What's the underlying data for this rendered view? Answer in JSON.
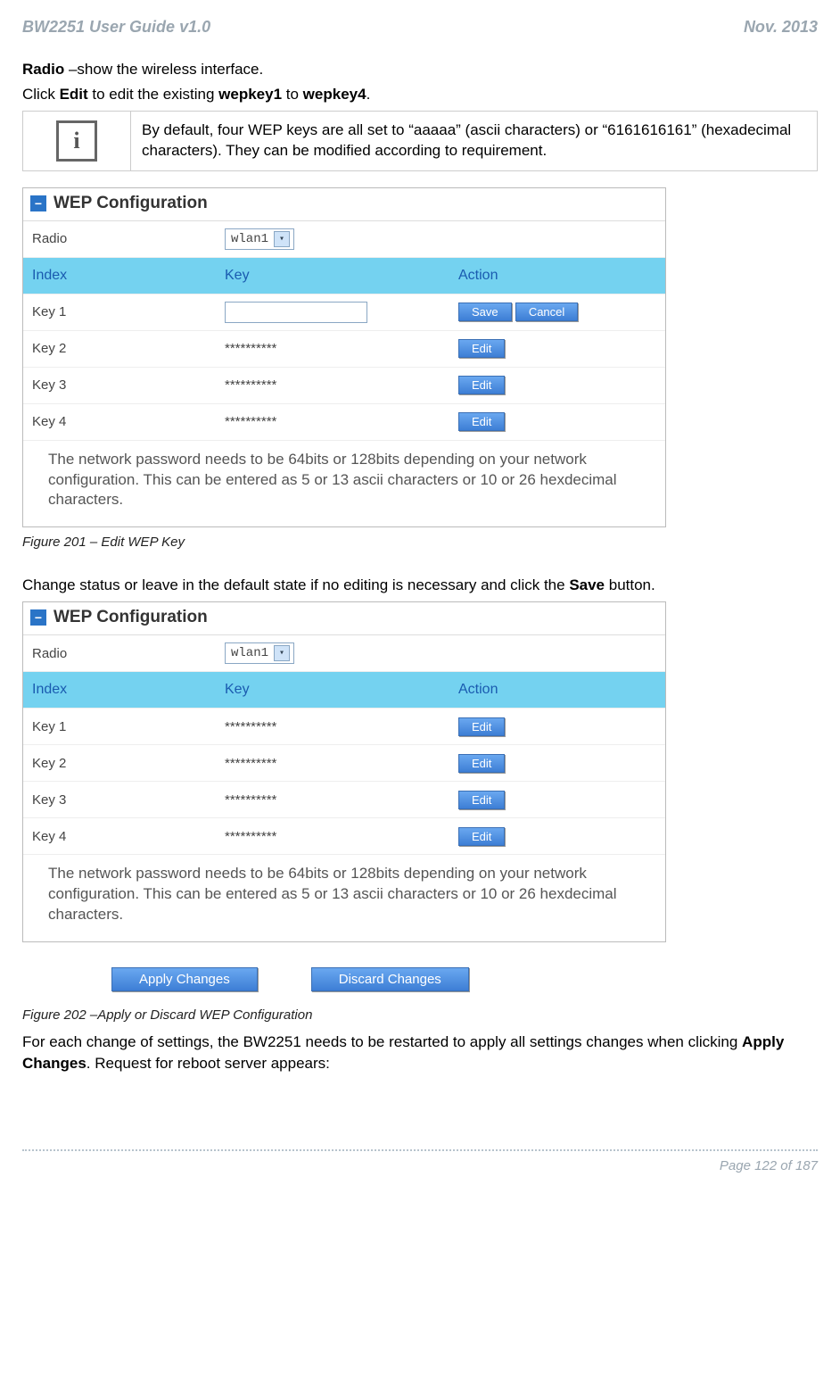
{
  "header": {
    "left": "BW2251 User Guide v1.0",
    "right": "Nov.  2013"
  },
  "intro": {
    "line1_pre": "Radio",
    "line1_rest": " –show the wireless interface.",
    "line2_pre": "Click ",
    "line2_b1": "Edit",
    "line2_mid": " to edit the existing ",
    "line2_b2": "wepkey1",
    "line2_mid2": " to ",
    "line2_b3": "wepkey4",
    "line2_end": "."
  },
  "note": {
    "icon_letter": "i",
    "text": "By default, four WEP keys are all set to “aaaaa” (ascii characters) or “6161616161” (hexadecimal characters). They can be modified according to requirement."
  },
  "panel": {
    "toggle": "−",
    "title": "WEP Configuration",
    "radio_label": "Radio",
    "radio_value": "wlan1",
    "col_index": "Index",
    "col_key": "Key",
    "col_action": "Action",
    "rows1": [
      {
        "label": "Key 1",
        "value": "",
        "mode": "edit"
      },
      {
        "label": "Key 2",
        "value": "**********",
        "mode": "view"
      },
      {
        "label": "Key 3",
        "value": "**********",
        "mode": "view"
      },
      {
        "label": "Key 4",
        "value": "**********",
        "mode": "view"
      }
    ],
    "rows2": [
      {
        "label": "Key 1",
        "value": "**********",
        "mode": "view"
      },
      {
        "label": "Key 2",
        "value": "**********",
        "mode": "view"
      },
      {
        "label": "Key 3",
        "value": "**********",
        "mode": "view"
      },
      {
        "label": "Key 4",
        "value": "**********",
        "mode": "view"
      }
    ],
    "btn_save": "Save",
    "btn_cancel": "Cancel",
    "btn_edit": "Edit",
    "panel_note": "The network password needs to be 64bits or 128bits depending on your network configuration. This can be entered as 5 or 13 ascii characters or 10 or 26 hexdecimal characters."
  },
  "caption1": "Figure 201 – Edit WEP Key",
  "mid_text_pre": "Change status or leave in the default state if no editing is necessary and click the ",
  "mid_text_b": "Save",
  "mid_text_end": " button.",
  "btn_apply": "Apply Changes",
  "btn_discard": "Discard Changes",
  "caption2": "Figure 202 –Apply or Discard WEP Configuration",
  "outro_pre": "For each change of settings, the BW2251 needs to be restarted to apply all settings changes when clicking ",
  "outro_b": "Apply Changes",
  "outro_end": ". Request for reboot server appears:",
  "footer": "Page 122 of 187"
}
